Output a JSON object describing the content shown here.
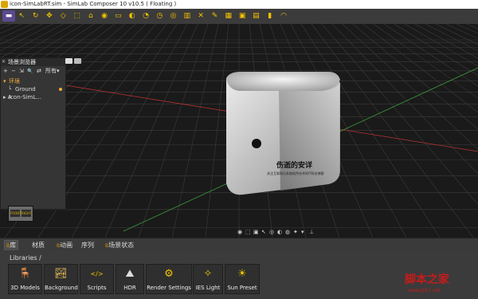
{
  "window": {
    "title": "icon-SimLabRT.sim - SimLab Composer 10 v10.5 ( Floating )"
  },
  "toolbar": {
    "buttons": [
      {
        "name": "scene-mode-icon",
        "glyph": "▬"
      },
      {
        "name": "select-tool-icon",
        "glyph": "↖"
      },
      {
        "name": "rotate-tool-icon",
        "glyph": "↻"
      },
      {
        "name": "move-tool-icon",
        "glyph": "✥"
      },
      {
        "name": "scale-tool-icon",
        "glyph": "◇"
      },
      {
        "name": "bounding-box-icon",
        "glyph": "⬚"
      },
      {
        "name": "camera-icon",
        "glyph": "⌂"
      },
      {
        "name": "light-icon",
        "glyph": "◉"
      },
      {
        "name": "plane-icon",
        "glyph": "▭"
      },
      {
        "name": "render-icon",
        "glyph": "◐"
      },
      {
        "name": "animation-icon",
        "glyph": "◔"
      },
      {
        "name": "clock-icon",
        "glyph": "◷"
      },
      {
        "name": "settings-icon",
        "glyph": "◎"
      },
      {
        "name": "layers-icon",
        "glyph": "▥"
      },
      {
        "name": "tools-icon",
        "glyph": "✕"
      },
      {
        "name": "measure-icon",
        "glyph": "✎"
      },
      {
        "name": "grid-icon",
        "glyph": "▦"
      },
      {
        "name": "snapshot-icon",
        "glyph": "▣"
      },
      {
        "name": "sequence-icon",
        "glyph": "▤"
      },
      {
        "name": "vr-icon",
        "glyph": "▮"
      },
      {
        "name": "headset-icon",
        "glyph": "◠"
      }
    ]
  },
  "scene_panel": {
    "title": "场景浏览器",
    "tools": {
      "add": "+",
      "remove": "−",
      "expand": "⇲",
      "search": "🔍",
      "refresh": "⇄"
    },
    "filter": "所有▾",
    "tree": [
      {
        "label": "环境",
        "indent": "▾",
        "level": 0,
        "color": "#f2a93b"
      },
      {
        "label": "Ground",
        "indent": "└",
        "level": 1,
        "color": "#dddddd"
      },
      {
        "label": "Icon-SimL...",
        "indent": "▸ A",
        "level": 0,
        "color": "#dddddd"
      }
    ]
  },
  "viewport": {
    "watermark_title": "伤逝的安详",
    "watermark_sub": "关注互联网与系统软件技术的IT科技博客",
    "nav_cube": {
      "left": "FRONT",
      "right": "RIGHT"
    },
    "toolbar_glyphs": [
      "◉",
      "⬚",
      "▣",
      "↖",
      "◎",
      "◐",
      "◍",
      "✦",
      "▾",
      "⊥"
    ]
  },
  "tabs": [
    {
      "label": "库",
      "prefix": "B",
      "active": true
    },
    {
      "label": "材质",
      "prefix": "",
      "active": false
    },
    {
      "label": "动画",
      "prefix": "B",
      "active": false
    },
    {
      "label": "序列",
      "prefix": "",
      "active": false
    },
    {
      "label": "场景状态",
      "prefix": "B",
      "active": false
    }
  ],
  "libraries": {
    "path": "Libraries /",
    "items": [
      {
        "label": "3D Models",
        "icon": "chair-icon",
        "glyph": "🪑",
        "color": "#e8b71a"
      },
      {
        "label": "Background",
        "icon": "landscape-icon",
        "glyph": "🏞",
        "color": "#f0c25a"
      },
      {
        "label": "Scripts",
        "icon": "code-icon",
        "glyph": "</>",
        "color": "#f3c200"
      },
      {
        "label": "HDR",
        "icon": "hdr-icon",
        "glyph": "⛰",
        "color": "#ddd"
      },
      {
        "label": "Render Settings",
        "icon": "gear-icon",
        "glyph": "⚙",
        "color": "#f3c200"
      },
      {
        "label": "IES Light",
        "icon": "ies-light-icon",
        "glyph": "✧",
        "color": "#f3c200"
      },
      {
        "label": "Sun Preset",
        "icon": "sun-icon",
        "glyph": "☀",
        "color": "#f3c200"
      }
    ]
  },
  "site_watermark": {
    "text": "脚本之家",
    "url": "www.jb51.net"
  },
  "colors": {
    "accent": "#f3c200",
    "active_tool": "#5b4a8f",
    "panel_bg": "#353535",
    "viewport_bg": "#1a1a1a",
    "axis_red": "#b83232",
    "axis_green": "#3c9a3c"
  }
}
